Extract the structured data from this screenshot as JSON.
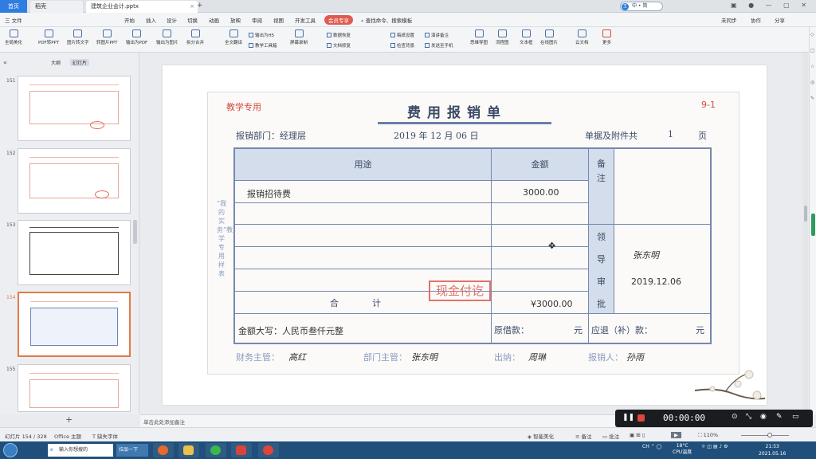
{
  "tabs": {
    "home": "首页",
    "tab1": "稻壳",
    "tab2": "建筑企业会计.pptx",
    "add": "+"
  },
  "title_badge": "中 • 简",
  "menu": {
    "file": "三 文件",
    "items": [
      "开始",
      "插入",
      "设计",
      "切换",
      "动画",
      "放映",
      "审阅",
      "视图",
      "开发工具",
      "会员专享"
    ],
    "search": "查找命令、搜索模板",
    "right": [
      "未同步",
      "协作",
      "分享"
    ]
  },
  "toolbar": {
    "big": [
      "全局美化",
      "PDF转PPT",
      "图片转文字",
      "转图片PPT",
      "输出为PDF",
      "输出为图片",
      "拆分合并",
      "全文翻译",
      "屏幕录制",
      "思维导图",
      "流程图",
      "文本框",
      "在线图片",
      "云文档",
      "更多"
    ],
    "small": [
      "输出为H5",
      "教学工具箱",
      "数据恢复",
      "文档修复",
      "稿纸设置",
      "检查背景",
      "演讲备注",
      "发送至手机"
    ]
  },
  "left": {
    "outline": "大纲",
    "slides": "幻灯片",
    "thumbs": [
      {
        "num": "151"
      },
      {
        "num": "152"
      },
      {
        "num": "153"
      },
      {
        "num": "154"
      },
      {
        "num": "155"
      }
    ]
  },
  "doc": {
    "tag": "教学专用",
    "title": "费用报销单",
    "num": "9-1",
    "dept_label": "报销部门：经理层",
    "date": "2019 年  12 月  06 日",
    "attach_label": "单据及附件共",
    "attach_count": "1",
    "attach_unit": "页",
    "side_text": "“我的实务”教学专用样表",
    "col_purpose": "用途",
    "col_amount": "金额",
    "col_note": "备注",
    "col_approve": "领导审批",
    "row1_purpose": "报销招待费",
    "row1_amount": "3000.00",
    "total_label": "合            计",
    "total_amount": "¥3000.00",
    "approver_sign": "张东明",
    "approve_date": "2019.12.06",
    "stamp": "现金付讫",
    "words_label": "金额大写：人民币叁仟元整",
    "borrow_label": "原借款：",
    "borrow_unit": "元",
    "refund_label": "应退（补）款：",
    "refund_unit": "元",
    "finance_label": "财务主管：",
    "finance_sign": "高红",
    "dept_head_label": "部门主管：",
    "dept_head_sign": "张东明",
    "cashier_label": "出纳：",
    "cashier_sign": "周琳",
    "claimant_label": "报销人：",
    "claimant_sign": "孙雨"
  },
  "notes": "单击此处添加备注",
  "status": {
    "slide": "幻灯片 154 / 328",
    "theme": "Office 主题",
    "font": "缺失字体",
    "smart": "智能美化",
    "comment": "备注",
    "annotate": "批注",
    "zoom": "110%"
  },
  "recorder": {
    "time": "00:00:00"
  },
  "taskbar": {
    "input": "输入你想搜的",
    "task": "拉品一下",
    "weather": "18°C",
    "cpu": "CPU温度",
    "date": "2021.05.16",
    "time": "21:53"
  }
}
